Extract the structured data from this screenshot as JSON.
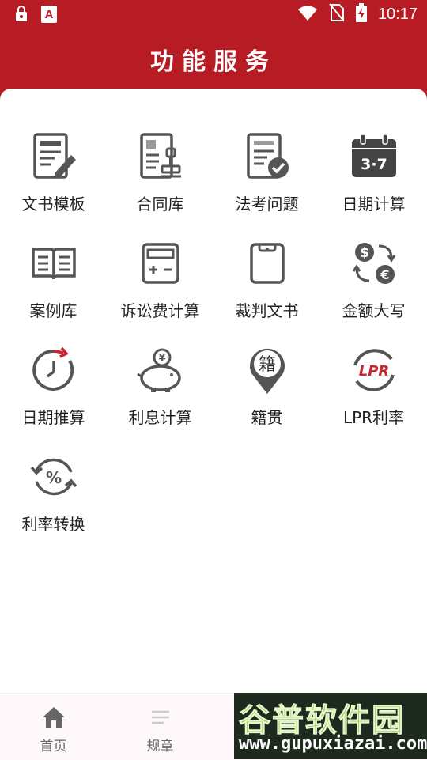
{
  "status_bar": {
    "time": "10:17",
    "left_icons": [
      "lock-shield-icon",
      "a-app-icon"
    ],
    "right_icons": [
      "wifi-icon",
      "no-sim-icon",
      "battery-charging-icon"
    ]
  },
  "header": {
    "title": "功能服务"
  },
  "functions": [
    {
      "label": "文书模板",
      "icon": "document-edit-icon"
    },
    {
      "label": "合同库",
      "icon": "contract-stamp-icon"
    },
    {
      "label": "法考问题",
      "icon": "document-check-icon"
    },
    {
      "label": "日期计算",
      "icon": "calendar-icon",
      "icon_text": "3·7"
    },
    {
      "label": "案例库",
      "icon": "book-icon"
    },
    {
      "label": "诉讼费计算",
      "icon": "calculator-icon"
    },
    {
      "label": "裁判文书",
      "icon": "tablet-icon"
    },
    {
      "label": "金额大写",
      "icon": "currency-exchange-icon"
    },
    {
      "label": "日期推算",
      "icon": "clock-refresh-icon"
    },
    {
      "label": "利息计算",
      "icon": "piggy-bank-icon"
    },
    {
      "label": "籍贯",
      "icon": "location-pin-icon",
      "icon_text": "籍"
    },
    {
      "label": "LPR利率",
      "icon": "lpr-icon",
      "icon_text": "LPR"
    },
    {
      "label": "利率转换",
      "icon": "percent-cycle-icon",
      "icon_text": "%"
    }
  ],
  "bottom_nav": [
    {
      "label": "首页",
      "icon": "home-icon"
    },
    {
      "label": "规章",
      "icon": "list-icon"
    }
  ],
  "watermark": {
    "main": "谷普软件园",
    "url": "www.gupuxiazai.com"
  },
  "colors": {
    "brand": "#b71c24",
    "icon_gray": "#555555",
    "accent_red": "#c8262e"
  }
}
